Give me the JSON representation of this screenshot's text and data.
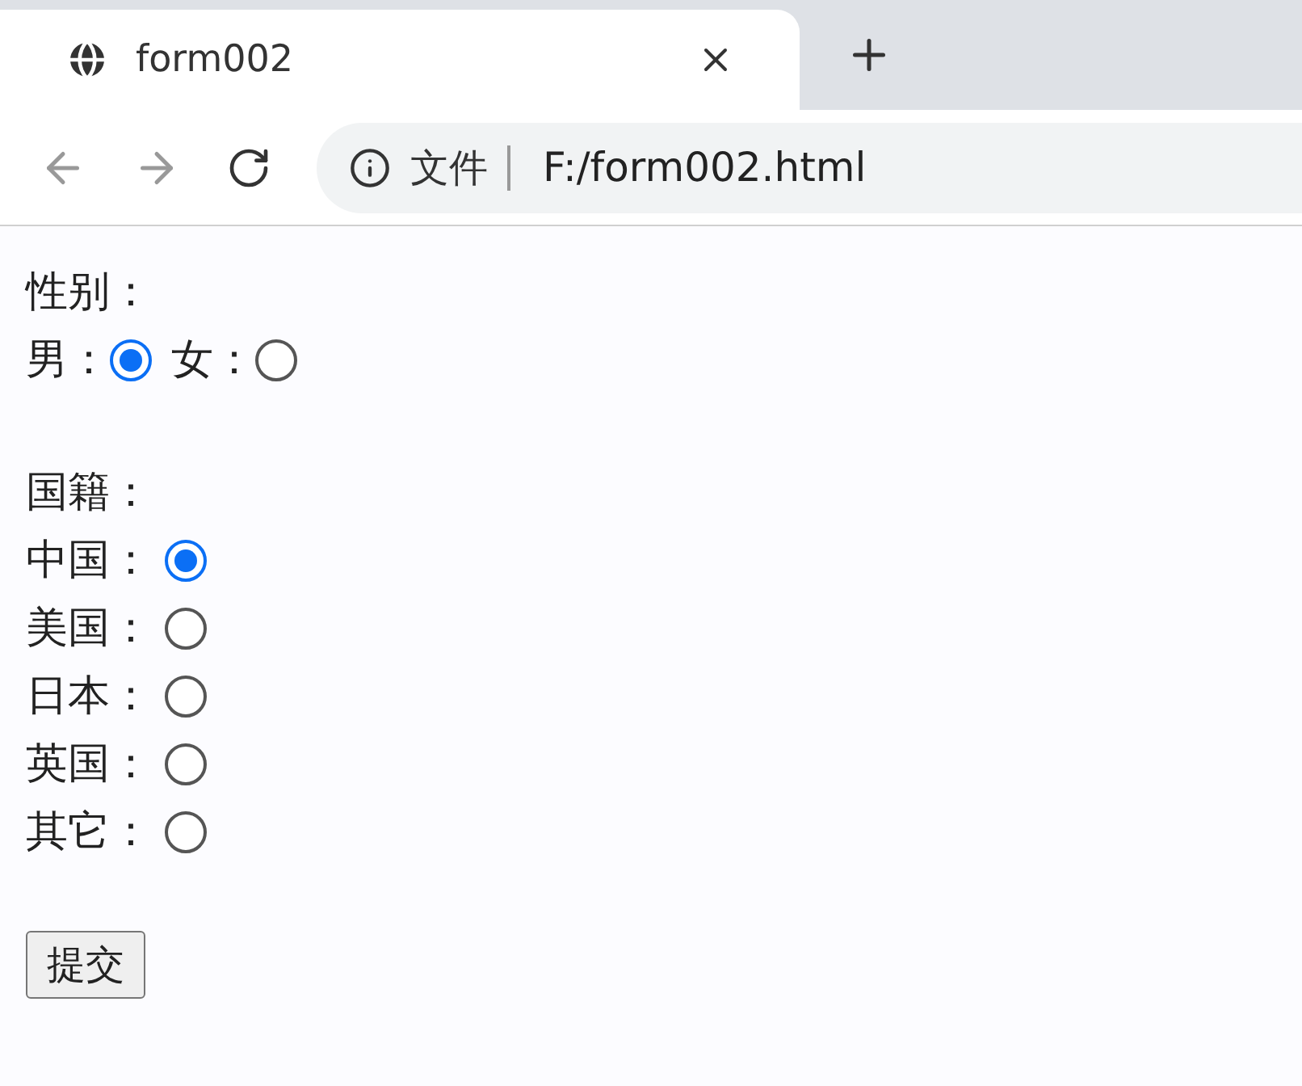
{
  "browser": {
    "tab": {
      "title": "form002"
    },
    "address": {
      "security_label": "文件",
      "url": "F:/form002.html"
    }
  },
  "form": {
    "groups": [
      {
        "heading": "性别：",
        "kind": "inline",
        "options": [
          {
            "label": "男：",
            "selected": true
          },
          {
            "label": "女：",
            "selected": false
          }
        ]
      },
      {
        "heading": "国籍：",
        "kind": "stacked",
        "options": [
          {
            "label": "中国：",
            "selected": true
          },
          {
            "label": "美国：",
            "selected": false
          },
          {
            "label": "日本：",
            "selected": false
          },
          {
            "label": "英国：",
            "selected": false
          },
          {
            "label": "其它：",
            "selected": false
          }
        ]
      }
    ],
    "submit": "提交"
  }
}
